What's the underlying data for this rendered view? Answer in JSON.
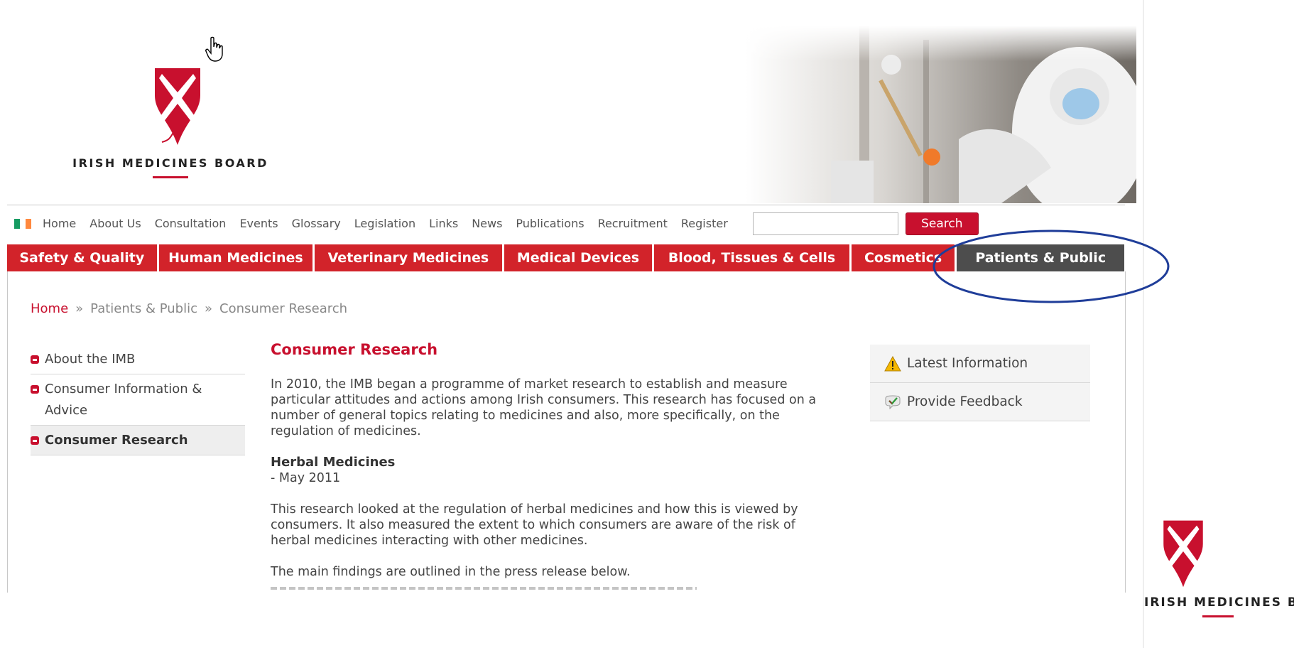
{
  "brand": {
    "name": "IRISH MEDICINES BOARD"
  },
  "icons": {
    "cursor": "hand-pointer-icon",
    "flag": "irish-flag-icon",
    "warning": "warning-triangle-icon",
    "feedback": "feedback-check-icon"
  },
  "colors": {
    "brand_red": "#c8102e",
    "nav_red": "#d2232a",
    "nav_active": "#4d4d4d",
    "annotation_blue": "#1f3d99"
  },
  "topnav": {
    "links": [
      "Home",
      "About Us",
      "Consultation",
      "Events",
      "Glossary",
      "Legislation",
      "Links",
      "News",
      "Publications",
      "Recruitment",
      "Register"
    ],
    "search_value": "",
    "search_button": "Search"
  },
  "mainnav": {
    "items": [
      "Safety & Quality",
      "Human Medicines",
      "Veterinary Medicines",
      "Medical Devices",
      "Blood, Tissues & Cells",
      "Cosmetics",
      "Patients & Public"
    ],
    "active": "Patients & Public"
  },
  "breadcrumb": {
    "home": "Home",
    "separator": "»",
    "parent": "Patients & Public",
    "current": "Consumer Research"
  },
  "sidemenu": {
    "items": [
      "About the IMB",
      "Consumer Information & Advice",
      "Consumer Research"
    ],
    "active": "Consumer Research"
  },
  "article": {
    "title": "Consumer Research",
    "intro": "In 2010, the IMB began a programme of market research to establish and measure particular attitudes and actions among Irish consumers. This research has focused on a number of general topics relating to medicines and also, more specifically, on the regulation of medicines.",
    "section_title": "Herbal Medicines",
    "section_date": "- May 2011",
    "section_body": "This research looked at the regulation of herbal medicines and how this is viewed by consumers. It also measured the extent to which consumers are aware of the risk of herbal medicines interacting with other medicines.",
    "findings": "The main findings are outlined in the press release below."
  },
  "infobox": {
    "latest": "Latest Information",
    "feedback": "Provide Feedback"
  }
}
